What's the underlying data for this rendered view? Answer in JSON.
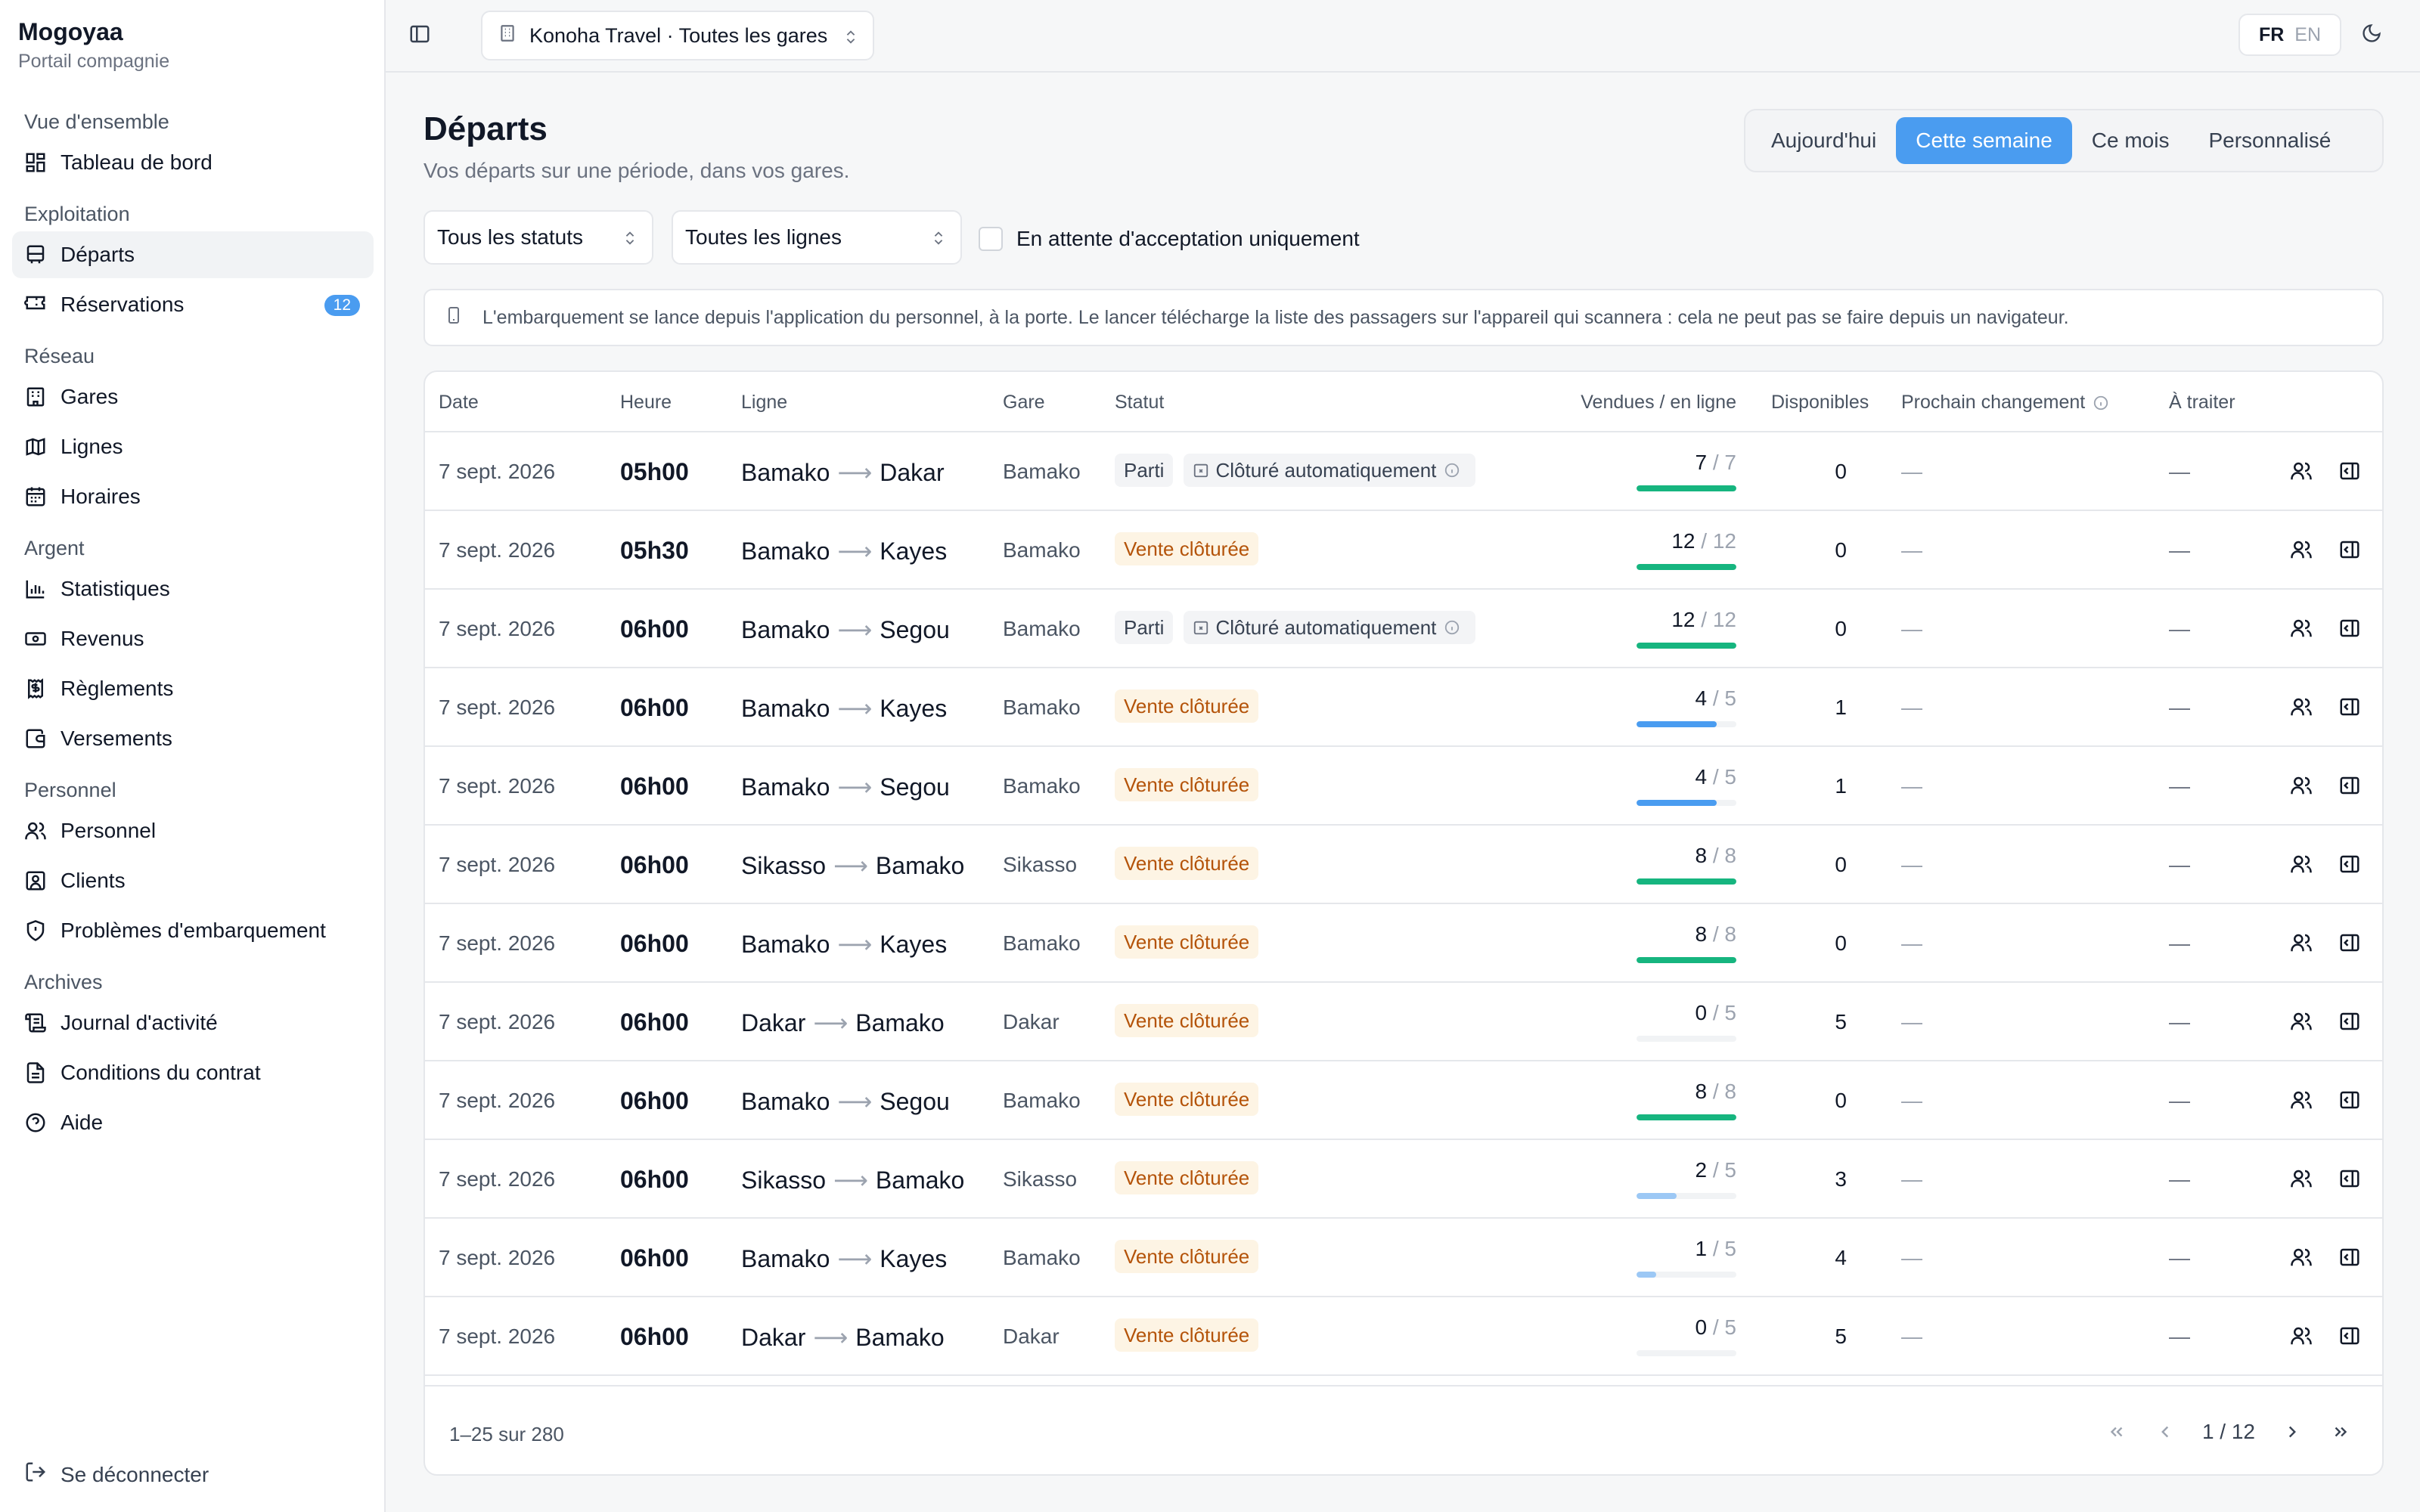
{
  "sidebar": {
    "brand_name": "Mogoyaa",
    "brand_sub": "Portail compagnie",
    "sections": [
      {
        "title": "Vue d'ensemble",
        "items": [
          {
            "label": "Tableau de bord",
            "icon": "dashboard-icon"
          }
        ]
      },
      {
        "title": "Exploitation",
        "items": [
          {
            "label": "Départs",
            "icon": "bus-icon",
            "active": true
          },
          {
            "label": "Réservations",
            "icon": "ticket-icon",
            "badge": "12"
          }
        ]
      },
      {
        "title": "Réseau",
        "items": [
          {
            "label": "Gares",
            "icon": "building-icon"
          },
          {
            "label": "Lignes",
            "icon": "map-icon"
          },
          {
            "label": "Horaires",
            "icon": "calendar-icon"
          }
        ]
      },
      {
        "title": "Argent",
        "items": [
          {
            "label": "Statistiques",
            "icon": "bar-chart-icon"
          },
          {
            "label": "Revenus",
            "icon": "banknote-icon"
          },
          {
            "label": "Règlements",
            "icon": "receipt-icon"
          },
          {
            "label": "Versements",
            "icon": "wallet-icon"
          }
        ]
      },
      {
        "title": "Personnel",
        "items": [
          {
            "label": "Personnel",
            "icon": "users-icon"
          },
          {
            "label": "Clients",
            "icon": "contact-icon"
          },
          {
            "label": "Problèmes d'embarquement",
            "icon": "shield-alert-icon"
          }
        ]
      },
      {
        "title": "Archives",
        "items": [
          {
            "label": "Journal d'activité",
            "icon": "scroll-icon"
          },
          {
            "label": "Conditions du contrat",
            "icon": "file-text-icon"
          },
          {
            "label": "Aide",
            "icon": "help-circle-icon"
          }
        ]
      }
    ],
    "logout": "Se déconnecter"
  },
  "topbar": {
    "company": "Konoha Travel · Toutes les gares",
    "lang_fr": "FR",
    "lang_en": "EN"
  },
  "header": {
    "title": "Départs",
    "subtitle": "Vos départs sur une période, dans vos gares.",
    "periods": [
      "Aujourd'hui",
      "Cette semaine",
      "Ce mois",
      "Personnalisé"
    ],
    "active_period": "Cette semaine"
  },
  "filters": {
    "status": "Tous les statuts",
    "lines": "Toutes les lignes",
    "pending_only": "En attente d'acceptation uniquement"
  },
  "info": "L'embarquement se lance depuis l'application du personnel, à la porte. Le lancer télécharge la liste des passagers sur l'appareil qui scannera : cela ne peut pas se faire depuis un navigateur.",
  "table": {
    "headers": {
      "date": "Date",
      "time": "Heure",
      "line": "Ligne",
      "station": "Gare",
      "status": "Statut",
      "sold": "Vendues / en ligne",
      "available": "Disponibles",
      "next_change": "Prochain changement",
      "todo": "À traiter"
    },
    "rows": [
      {
        "date": "7 sept. 2026",
        "time": "05h00",
        "from": "Bamako",
        "to": "Dakar",
        "station": "Bamako",
        "status": "Parti",
        "status_kind": "gray",
        "auto": "Clôturé automatiquement",
        "sold": 7,
        "total": 7,
        "available": "0",
        "next": "—",
        "todo": "—"
      },
      {
        "date": "7 sept. 2026",
        "time": "05h30",
        "from": "Bamako",
        "to": "Kayes",
        "station": "Bamako",
        "status": "Vente clôturée",
        "status_kind": "orange",
        "sold": 12,
        "total": 12,
        "available": "0",
        "next": "—",
        "todo": "—"
      },
      {
        "date": "7 sept. 2026",
        "time": "06h00",
        "from": "Bamako",
        "to": "Segou",
        "station": "Bamako",
        "status": "Parti",
        "status_kind": "gray",
        "auto": "Clôturé automatiquement",
        "sold": 12,
        "total": 12,
        "available": "0",
        "next": "—",
        "todo": "—"
      },
      {
        "date": "7 sept. 2026",
        "time": "06h00",
        "from": "Bamako",
        "to": "Kayes",
        "station": "Bamako",
        "status": "Vente clôturée",
        "status_kind": "orange",
        "sold": 4,
        "total": 5,
        "available": "1",
        "next": "—",
        "todo": "—"
      },
      {
        "date": "7 sept. 2026",
        "time": "06h00",
        "from": "Bamako",
        "to": "Segou",
        "station": "Bamako",
        "status": "Vente clôturée",
        "status_kind": "orange",
        "sold": 4,
        "total": 5,
        "available": "1",
        "next": "—",
        "todo": "—"
      },
      {
        "date": "7 sept. 2026",
        "time": "06h00",
        "from": "Sikasso",
        "to": "Bamako",
        "station": "Sikasso",
        "status": "Vente clôturée",
        "status_kind": "orange",
        "sold": 8,
        "total": 8,
        "available": "0",
        "next": "—",
        "todo": "—"
      },
      {
        "date": "7 sept. 2026",
        "time": "06h00",
        "from": "Bamako",
        "to": "Kayes",
        "station": "Bamako",
        "status": "Vente clôturée",
        "status_kind": "orange",
        "sold": 8,
        "total": 8,
        "available": "0",
        "next": "—",
        "todo": "—"
      },
      {
        "date": "7 sept. 2026",
        "time": "06h00",
        "from": "Dakar",
        "to": "Bamako",
        "station": "Dakar",
        "status": "Vente clôturée",
        "status_kind": "orange",
        "sold": 0,
        "total": 5,
        "available": "5",
        "next": "—",
        "todo": "—"
      },
      {
        "date": "7 sept. 2026",
        "time": "06h00",
        "from": "Bamako",
        "to": "Segou",
        "station": "Bamako",
        "status": "Vente clôturée",
        "status_kind": "orange",
        "sold": 8,
        "total": 8,
        "available": "0",
        "next": "—",
        "todo": "—"
      },
      {
        "date": "7 sept. 2026",
        "time": "06h00",
        "from": "Sikasso",
        "to": "Bamako",
        "station": "Sikasso",
        "status": "Vente clôturée",
        "status_kind": "orange",
        "sold": 2,
        "total": 5,
        "available": "3",
        "next": "—",
        "todo": "—"
      },
      {
        "date": "7 sept. 2026",
        "time": "06h00",
        "from": "Bamako",
        "to": "Kayes",
        "station": "Bamako",
        "status": "Vente clôturée",
        "status_kind": "orange",
        "sold": 1,
        "total": 5,
        "available": "4",
        "next": "—",
        "todo": "—"
      },
      {
        "date": "7 sept. 2026",
        "time": "06h00",
        "from": "Dakar",
        "to": "Bamako",
        "station": "Dakar",
        "status": "Vente clôturée",
        "status_kind": "orange",
        "sold": 0,
        "total": 5,
        "available": "5",
        "next": "—",
        "todo": "—"
      }
    ]
  },
  "pagination": {
    "range": "1–25 sur 280",
    "page": "1 / 12"
  },
  "colors": {
    "accent": "#4a9cf0",
    "bar_full": "#16b57f",
    "bar_partial": "#4a9cf0",
    "bar_low": "#9cc8f5",
    "badge_orange_text": "#b45309"
  }
}
